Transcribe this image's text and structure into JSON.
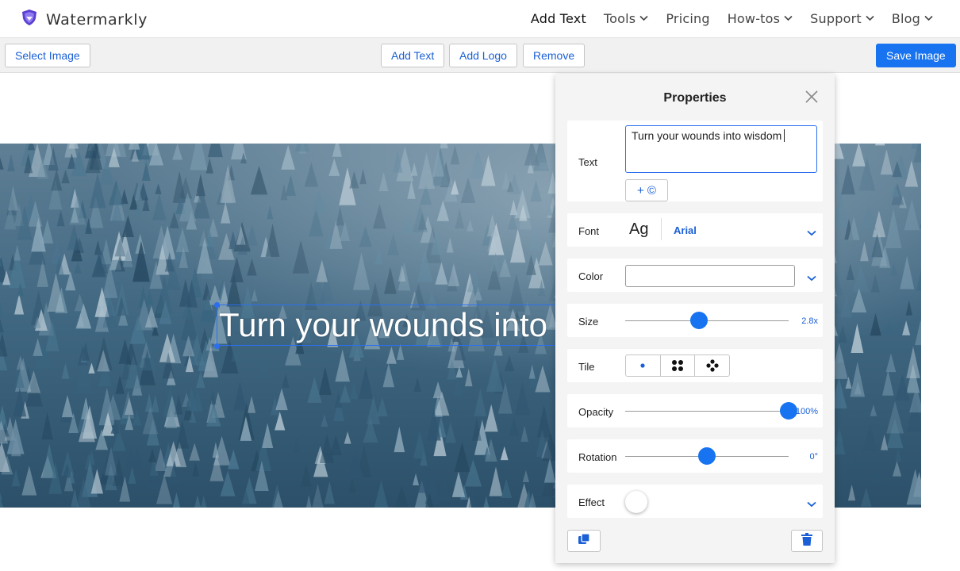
{
  "app": {
    "title": "Watermarkly",
    "logo_icon": "shield-icon",
    "accent": "#1873f0"
  },
  "nav": {
    "items": [
      {
        "label": "Add Text",
        "dropdown": false
      },
      {
        "label": "Tools",
        "dropdown": true
      },
      {
        "label": "Pricing",
        "dropdown": false
      },
      {
        "label": "How-tos",
        "dropdown": true
      },
      {
        "label": "Support",
        "dropdown": true
      },
      {
        "label": "Blog",
        "dropdown": true
      }
    ]
  },
  "toolbar": {
    "select_image": "Select Image",
    "add_text": "Add Text",
    "add_logo": "Add Logo",
    "remove": "Remove",
    "save_image": "Save Image"
  },
  "canvas": {
    "watermark_text": "Turn your wounds into w"
  },
  "properties": {
    "title": "Properties",
    "text_label": "Text",
    "text_value": "Turn your wounds into wisdom",
    "copyright_button": "+ ©",
    "font_label": "Font",
    "font_preview": "Ag",
    "font_name": "Arial",
    "color_label": "Color",
    "color_value": "#ffffff",
    "size_label": "Size",
    "size_value": "2.8x",
    "size_fraction": 0.45,
    "tile_label": "Tile",
    "tile_options": [
      "single-dot-icon",
      "four-dots-icon",
      "diamond-dots-icon"
    ],
    "opacity_label": "Opacity",
    "opacity_value": "100%",
    "opacity_fraction": 1.0,
    "rotation_label": "Rotation",
    "rotation_value": "0°",
    "rotation_fraction": 0.5,
    "effect_label": "Effect",
    "effect_on": false
  }
}
